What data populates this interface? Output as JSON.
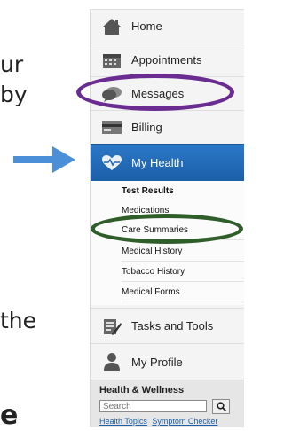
{
  "tutorial_fragments": [
    "ur",
    "by",
    "the",
    "e"
  ],
  "menu": {
    "items": [
      {
        "label": "Home",
        "icon": "home-icon"
      },
      {
        "label": "Appointments",
        "icon": "calendar-icon"
      },
      {
        "label": "Messages",
        "icon": "speech-bubble-icon"
      },
      {
        "label": "Billing",
        "icon": "credit-card-icon"
      },
      {
        "label": "My Health",
        "icon": "heart-pulse-icon"
      }
    ],
    "sub_items": [
      "Test Results",
      "Medications",
      "Care Summaries",
      "Medical History",
      "Tobacco History",
      "Medical Forms"
    ],
    "lower_items": [
      {
        "label": "Tasks and Tools",
        "icon": "clipboard-pen-icon"
      },
      {
        "label": "My Profile",
        "icon": "person-icon"
      }
    ]
  },
  "health_wellness": {
    "title": "Health & Wellness",
    "search_placeholder": "Search",
    "links": [
      "Health Topics",
      "Symptom Checker"
    ]
  },
  "colors": {
    "active_blue": "#1f65b0",
    "arrow_blue": "#4a8fd8",
    "purple_ring": "#6a2c91",
    "green_ring": "#2f5e2a"
  }
}
